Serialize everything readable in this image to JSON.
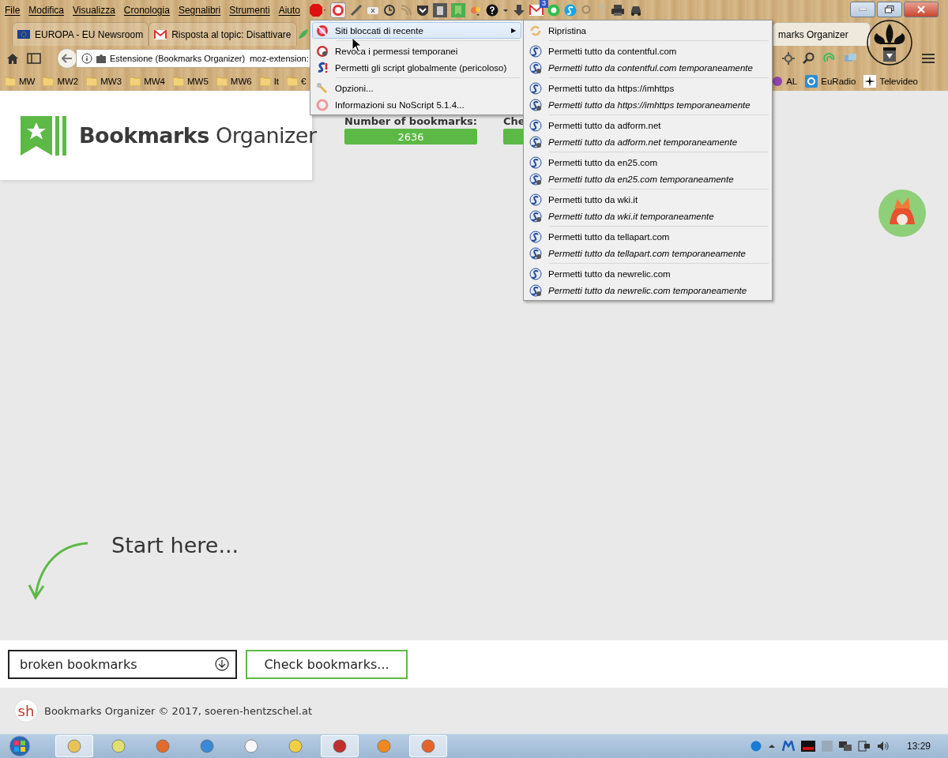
{
  "menubar": {
    "items": [
      "File",
      "Modifica",
      "Visualizza",
      "Cronologia",
      "Segnalibri",
      "Strumenti",
      "Aiuto"
    ],
    "mail_badge": "3"
  },
  "tabs": [
    {
      "label": "EUROPA - EU Newsroom",
      "selected": false
    },
    {
      "label": "Risposta al topic: Disattivare",
      "selected": false
    },
    {
      "label": "marks Organizer",
      "selected": true
    }
  ],
  "address_bar": {
    "identity": "Estensione (Bookmarks Organizer)",
    "url": "moz-extension:"
  },
  "bookmarks_bar": {
    "folders": [
      "MW",
      "MW2",
      "MW3",
      "MW4",
      "MW5",
      "MW6",
      "It",
      "€"
    ],
    "links": [
      {
        "label": "AL"
      },
      {
        "label": "EuRadio"
      },
      {
        "label": "Televideo"
      }
    ]
  },
  "page": {
    "logo": {
      "bold": "Bookmarks",
      "light": "Organizer"
    },
    "stats": [
      {
        "label": "Number of bookmarks:",
        "value": "2636"
      },
      {
        "label": "Che"
      }
    ],
    "start_hint": "Start here...",
    "mode_select": {
      "value": "broken bookmarks"
    },
    "check_button": "Check bookmarks...",
    "footer_logo": "sh",
    "footer": "Bookmarks Organizer © 2017, soeren-hentzschel.at"
  },
  "noscript_menu": {
    "submenu_arrow": "▶",
    "groups": [
      [
        {
          "label": "Siti bloccati di recente",
          "submenu": true,
          "selected": true
        }
      ],
      [
        {
          "label": "Revoca i permessi temporanei",
          "submenu": false,
          "selected": false
        },
        {
          "label": "Permetti gli script globalmente (pericoloso)",
          "submenu": false,
          "selected": false
        }
      ],
      [
        {
          "label": "Opzioni...",
          "submenu": false,
          "selected": false
        },
        {
          "label": "Informazioni su NoScript 5.1.4...",
          "submenu": false,
          "selected": false
        }
      ]
    ]
  },
  "blocked_sites_submenu": {
    "restore": "Ripristina",
    "sites": [
      {
        "allow": "Permetti tutto da contentful.com",
        "allow_temporarily": "Permetti tutto da contentful.com temporaneamente"
      },
      {
        "allow": "Permetti tutto da https://imhttps",
        "allow_temporarily": "Permetti tutto da https://imhttps temporaneamente"
      },
      {
        "allow": "Permetti tutto da adform.net",
        "allow_temporarily": "Permetti tutto da adform.net temporaneamente"
      },
      {
        "allow": "Permetti tutto da en25.com",
        "allow_temporarily": "Permetti tutto da en25.com temporaneamente"
      },
      {
        "allow": "Permetti tutto da wki.it",
        "allow_temporarily": "Permetti tutto da wki.it temporaneamente"
      },
      {
        "allow": "Permetti tutto da tellapart.com",
        "allow_temporarily": "Permetti tutto da tellapart.com temporaneamente"
      },
      {
        "allow": "Permetti tutto da newrelic.com",
        "allow_temporarily": "Permetti tutto da newrelic.com temporaneamente"
      }
    ]
  },
  "taskbar": {
    "clock": "13:29"
  }
}
